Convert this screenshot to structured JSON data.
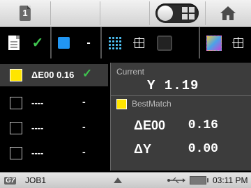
{
  "topbar": {
    "page_number": "1"
  },
  "toolbar": {
    "color_dash": "-"
  },
  "list": {
    "rows": [
      {
        "label": "ΔE00 0.16",
        "tail": "✓"
      },
      {
        "label": "----",
        "tail": "-"
      },
      {
        "label": "----",
        "tail": "-"
      },
      {
        "label": "----",
        "tail": "-"
      }
    ]
  },
  "panel": {
    "current_label": "Current",
    "current_value": "Y 1.19",
    "bestmatch_label": "BestMatch",
    "metrics": [
      {
        "name": "ΔE00",
        "value": "0.16"
      },
      {
        "name": "ΔY",
        "value": "0.00"
      }
    ]
  },
  "status": {
    "g7_badge": "G7",
    "job_name": "JOB1",
    "time": "03:11 PM"
  },
  "colors": {
    "selected_swatch": "#ffe500",
    "check_green": "#3fc44f",
    "blue_accent": "#2196f3",
    "panel_bg": "#3c3c3c"
  },
  "icons": [
    "page-number-icon",
    "toggle-switch",
    "grid-icon",
    "home-icon",
    "document-icon",
    "check-icon",
    "blue-swatch-icon",
    "pattern-icon",
    "target-icon",
    "layers-icon",
    "color-patch-icon",
    "triangle-up-icon",
    "usb-icon",
    "battery-icon"
  ]
}
